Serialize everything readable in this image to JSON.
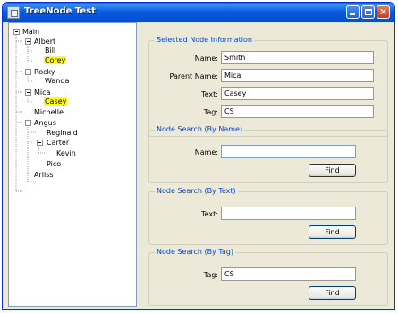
{
  "window": {
    "title": "TreeNode Test"
  },
  "tree": {
    "nodes": [
      {
        "label": "Main",
        "highlight": false
      },
      {
        "label": "Albert",
        "highlight": false
      },
      {
        "label": "Bill",
        "highlight": false
      },
      {
        "label": "Corey",
        "highlight": true
      },
      {
        "label": "Rocky",
        "highlight": false
      },
      {
        "label": "Wanda",
        "highlight": false
      },
      {
        "label": "Mica",
        "highlight": false
      },
      {
        "label": "Casey",
        "highlight": true
      },
      {
        "label": "Michelle",
        "highlight": false
      },
      {
        "label": "Angus",
        "highlight": false
      },
      {
        "label": "Reginald",
        "highlight": false
      },
      {
        "label": "Carter",
        "highlight": false
      },
      {
        "label": "Kevin",
        "highlight": false
      },
      {
        "label": "Pico",
        "highlight": false
      },
      {
        "label": "Arliss",
        "highlight": false
      }
    ],
    "highlight_color": "#ffff00"
  },
  "selected_info": {
    "title": "Selected Node Information",
    "name_label": "Name:",
    "name_value": "Smith",
    "parent_label": "Parent Name:",
    "parent_value": "Mica",
    "text_label": "Text:",
    "text_value": "Casey",
    "tag_label": "Tag:",
    "tag_value": "CS"
  },
  "search_by_name": {
    "title": "Node Search (By Name)",
    "label": "Name:",
    "value": "",
    "button": "Find"
  },
  "search_by_text": {
    "title": "Node Search (By Text)",
    "label": "Text:",
    "value": "",
    "button": "Find"
  },
  "search_by_tag": {
    "title": "Node Search (By Tag)",
    "label": "Tag:",
    "value": "CS",
    "button": "Find"
  },
  "colors": {
    "titlebar": "#0a5ce0",
    "group_title": "#0046d5",
    "panel_bg": "#ece9d8"
  }
}
